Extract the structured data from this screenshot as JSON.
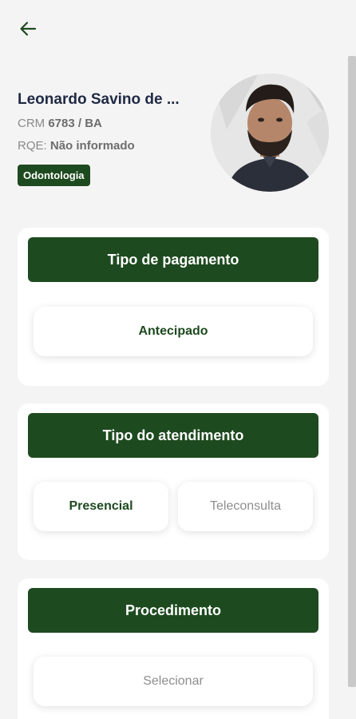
{
  "header": {
    "back_icon": "arrow-left-icon"
  },
  "doctor": {
    "name": "Leonardo Savino de ...",
    "crm_label": "CRM",
    "crm_value": "6783 / BA",
    "rqe_label": "RQE:",
    "rqe_value": "Não informado",
    "specialty": "Odontologia"
  },
  "sections": {
    "payment": {
      "title": "Tipo de pagamento",
      "options": [
        "Antecipado"
      ]
    },
    "service": {
      "title": "Tipo do atendimento",
      "options": [
        "Presencial",
        "Teleconsulta"
      ]
    },
    "procedure": {
      "title": "Procedimento",
      "placeholder": "Selecionar"
    }
  },
  "colors": {
    "primary": "#1e4a1f",
    "background": "#f5f4f4",
    "name_text": "#1f2a44"
  }
}
